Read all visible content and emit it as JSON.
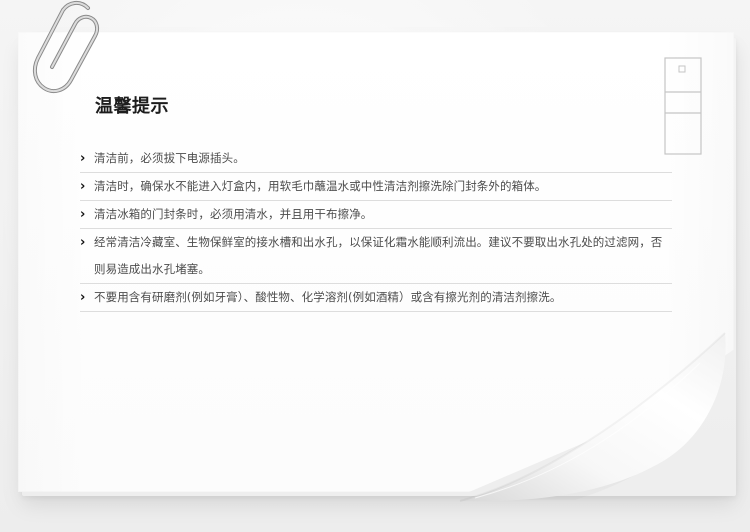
{
  "title": "温馨提示",
  "icons": {
    "paperclip": "paperclip-icon",
    "refrigerator": "refrigerator-icon",
    "bullet": "chevron-right-icon"
  },
  "colors": {
    "background": "#efefef",
    "paper": "#ffffff",
    "title": "#1d1d1d",
    "text": "#4c4c4c",
    "divider": "#dddddd",
    "icon": "#bdbdbd"
  },
  "tips": [
    {
      "bullet": "›",
      "text": "清洁前，必须拔下电源插头。"
    },
    {
      "bullet": "›",
      "text": "清洁时，确保水不能进入灯盒内，用软毛巾蘸温水或中性清洁剂擦洗除门封条外的箱体。"
    },
    {
      "bullet": "›",
      "text": "清洁冰箱的门封条时，必须用清水，并且用干布擦净。"
    },
    {
      "bullet": "›",
      "text": "经常清洁冷藏室、生物保鲜室的接水槽和出水孔，以保证化霜水能顺利流出。建议不要取出水孔处的过滤网，否则易造成出水孔堵塞。"
    },
    {
      "bullet": "›",
      "text": "不要用含有研磨剂(例如牙膏）、酸性物、化学溶剂(例如酒精）或含有擦光剂的清洁剂擦洗。"
    }
  ]
}
